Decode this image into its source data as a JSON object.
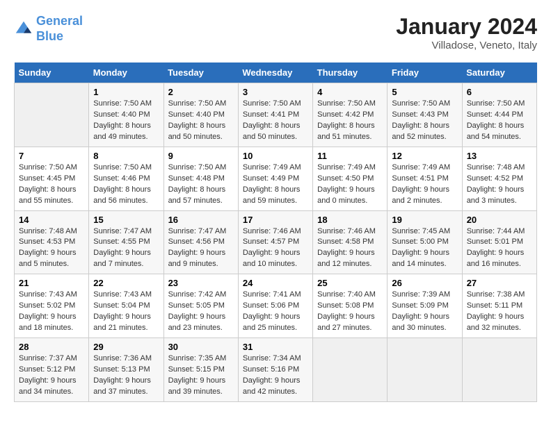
{
  "header": {
    "logo_line1": "General",
    "logo_line2": "Blue",
    "title": "January 2024",
    "subtitle": "Villadose, Veneto, Italy"
  },
  "days_of_week": [
    "Sunday",
    "Monday",
    "Tuesday",
    "Wednesday",
    "Thursday",
    "Friday",
    "Saturday"
  ],
  "weeks": [
    [
      {
        "num": "",
        "info": ""
      },
      {
        "num": "1",
        "info": "Sunrise: 7:50 AM\nSunset: 4:40 PM\nDaylight: 8 hours\nand 49 minutes."
      },
      {
        "num": "2",
        "info": "Sunrise: 7:50 AM\nSunset: 4:40 PM\nDaylight: 8 hours\nand 50 minutes."
      },
      {
        "num": "3",
        "info": "Sunrise: 7:50 AM\nSunset: 4:41 PM\nDaylight: 8 hours\nand 50 minutes."
      },
      {
        "num": "4",
        "info": "Sunrise: 7:50 AM\nSunset: 4:42 PM\nDaylight: 8 hours\nand 51 minutes."
      },
      {
        "num": "5",
        "info": "Sunrise: 7:50 AM\nSunset: 4:43 PM\nDaylight: 8 hours\nand 52 minutes."
      },
      {
        "num": "6",
        "info": "Sunrise: 7:50 AM\nSunset: 4:44 PM\nDaylight: 8 hours\nand 54 minutes."
      }
    ],
    [
      {
        "num": "7",
        "info": "Sunrise: 7:50 AM\nSunset: 4:45 PM\nDaylight: 8 hours\nand 55 minutes."
      },
      {
        "num": "8",
        "info": "Sunrise: 7:50 AM\nSunset: 4:46 PM\nDaylight: 8 hours\nand 56 minutes."
      },
      {
        "num": "9",
        "info": "Sunrise: 7:50 AM\nSunset: 4:48 PM\nDaylight: 8 hours\nand 57 minutes."
      },
      {
        "num": "10",
        "info": "Sunrise: 7:49 AM\nSunset: 4:49 PM\nDaylight: 8 hours\nand 59 minutes."
      },
      {
        "num": "11",
        "info": "Sunrise: 7:49 AM\nSunset: 4:50 PM\nDaylight: 9 hours\nand 0 minutes."
      },
      {
        "num": "12",
        "info": "Sunrise: 7:49 AM\nSunset: 4:51 PM\nDaylight: 9 hours\nand 2 minutes."
      },
      {
        "num": "13",
        "info": "Sunrise: 7:48 AM\nSunset: 4:52 PM\nDaylight: 9 hours\nand 3 minutes."
      }
    ],
    [
      {
        "num": "14",
        "info": "Sunrise: 7:48 AM\nSunset: 4:53 PM\nDaylight: 9 hours\nand 5 minutes."
      },
      {
        "num": "15",
        "info": "Sunrise: 7:47 AM\nSunset: 4:55 PM\nDaylight: 9 hours\nand 7 minutes."
      },
      {
        "num": "16",
        "info": "Sunrise: 7:47 AM\nSunset: 4:56 PM\nDaylight: 9 hours\nand 9 minutes."
      },
      {
        "num": "17",
        "info": "Sunrise: 7:46 AM\nSunset: 4:57 PM\nDaylight: 9 hours\nand 10 minutes."
      },
      {
        "num": "18",
        "info": "Sunrise: 7:46 AM\nSunset: 4:58 PM\nDaylight: 9 hours\nand 12 minutes."
      },
      {
        "num": "19",
        "info": "Sunrise: 7:45 AM\nSunset: 5:00 PM\nDaylight: 9 hours\nand 14 minutes."
      },
      {
        "num": "20",
        "info": "Sunrise: 7:44 AM\nSunset: 5:01 PM\nDaylight: 9 hours\nand 16 minutes."
      }
    ],
    [
      {
        "num": "21",
        "info": "Sunrise: 7:43 AM\nSunset: 5:02 PM\nDaylight: 9 hours\nand 18 minutes."
      },
      {
        "num": "22",
        "info": "Sunrise: 7:43 AM\nSunset: 5:04 PM\nDaylight: 9 hours\nand 21 minutes."
      },
      {
        "num": "23",
        "info": "Sunrise: 7:42 AM\nSunset: 5:05 PM\nDaylight: 9 hours\nand 23 minutes."
      },
      {
        "num": "24",
        "info": "Sunrise: 7:41 AM\nSunset: 5:06 PM\nDaylight: 9 hours\nand 25 minutes."
      },
      {
        "num": "25",
        "info": "Sunrise: 7:40 AM\nSunset: 5:08 PM\nDaylight: 9 hours\nand 27 minutes."
      },
      {
        "num": "26",
        "info": "Sunrise: 7:39 AM\nSunset: 5:09 PM\nDaylight: 9 hours\nand 30 minutes."
      },
      {
        "num": "27",
        "info": "Sunrise: 7:38 AM\nSunset: 5:11 PM\nDaylight: 9 hours\nand 32 minutes."
      }
    ],
    [
      {
        "num": "28",
        "info": "Sunrise: 7:37 AM\nSunset: 5:12 PM\nDaylight: 9 hours\nand 34 minutes."
      },
      {
        "num": "29",
        "info": "Sunrise: 7:36 AM\nSunset: 5:13 PM\nDaylight: 9 hours\nand 37 minutes."
      },
      {
        "num": "30",
        "info": "Sunrise: 7:35 AM\nSunset: 5:15 PM\nDaylight: 9 hours\nand 39 minutes."
      },
      {
        "num": "31",
        "info": "Sunrise: 7:34 AM\nSunset: 5:16 PM\nDaylight: 9 hours\nand 42 minutes."
      },
      {
        "num": "",
        "info": ""
      },
      {
        "num": "",
        "info": ""
      },
      {
        "num": "",
        "info": ""
      }
    ]
  ]
}
